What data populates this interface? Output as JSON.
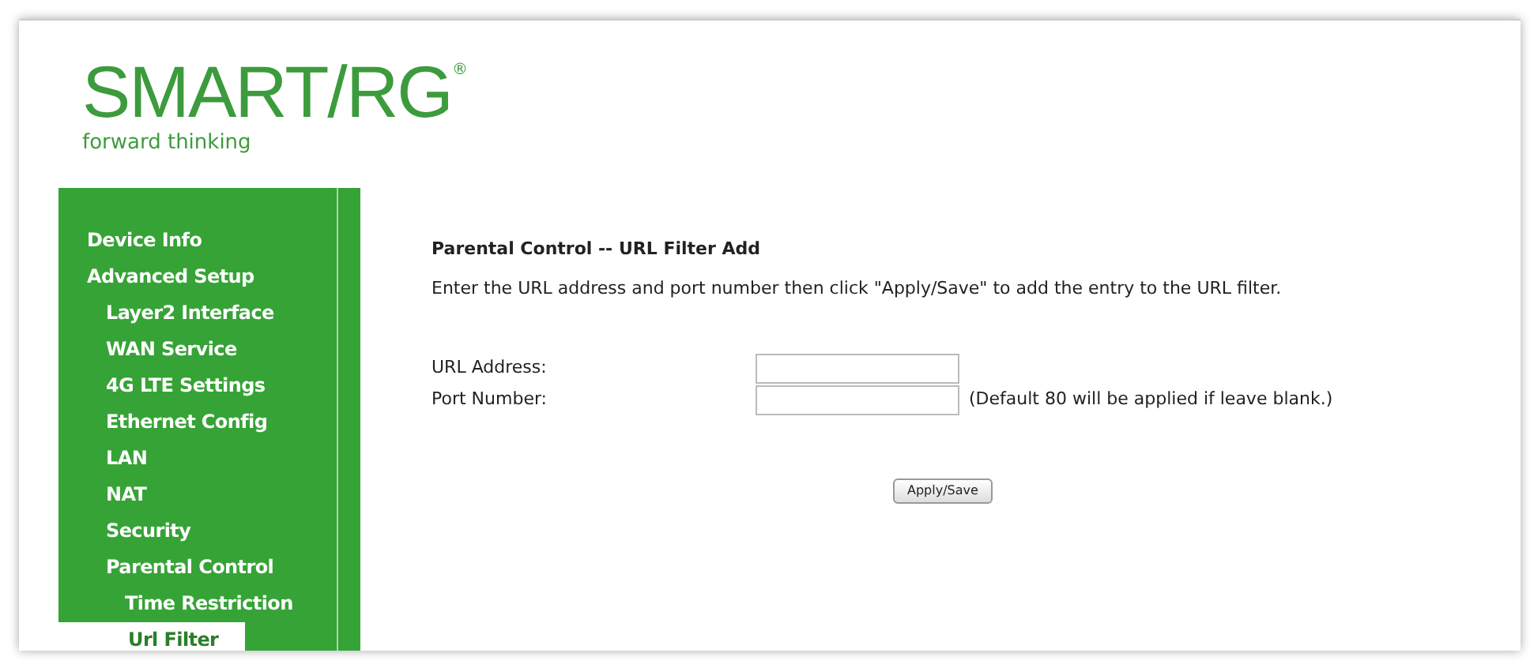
{
  "logo": {
    "name": "SMART/RG",
    "mark": "®",
    "tagline": "forward thinking"
  },
  "sidebar": {
    "items": [
      {
        "label": "Device Info",
        "selected": false
      },
      {
        "label": "Advanced Setup",
        "selected": false,
        "children": [
          {
            "label": "Layer2 Interface",
            "selected": false
          },
          {
            "label": "WAN Service",
            "selected": false
          },
          {
            "label": "4G LTE Settings",
            "selected": false
          },
          {
            "label": "Ethernet Config",
            "selected": false
          },
          {
            "label": "LAN",
            "selected": false
          },
          {
            "label": "NAT",
            "selected": false
          },
          {
            "label": "Security",
            "selected": false
          },
          {
            "label": "Parental Control",
            "selected": false,
            "children": [
              {
                "label": "Time Restriction",
                "selected": false
              },
              {
                "label": "Url Filter",
                "selected": true
              }
            ]
          }
        ]
      }
    ]
  },
  "content": {
    "title": "Parental Control -- URL Filter Add",
    "description": "Enter the URL address and port number then click \"Apply/Save\" to add the entry to the URL filter.",
    "fields": [
      {
        "label": "URL Address:"
      },
      {
        "label": "Port Number:",
        "note": "(Default 80 will be applied if leave blank.)"
      }
    ],
    "button": "Apply/Save"
  }
}
